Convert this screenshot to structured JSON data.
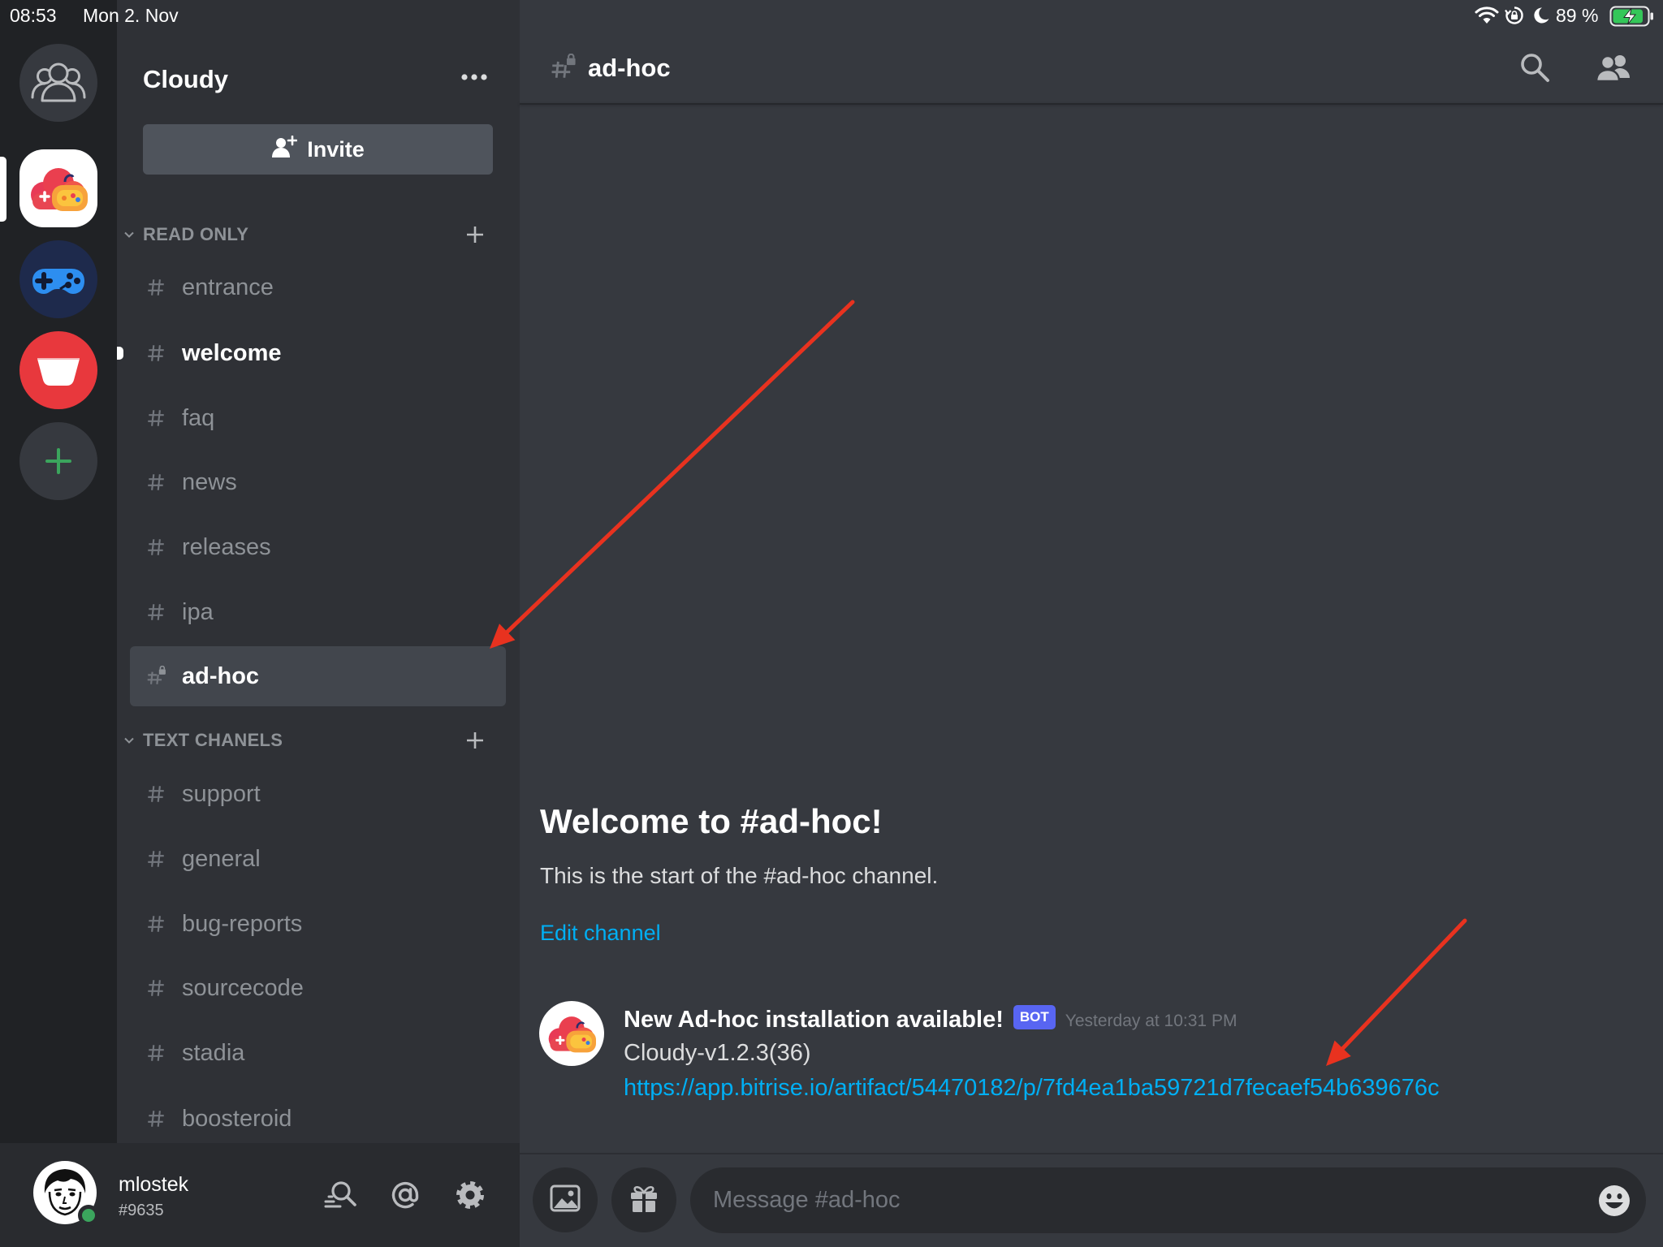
{
  "status_bar": {
    "time": "08:53",
    "date": "Mon 2. Nov",
    "battery": "89 %",
    "battery_level": 0.89,
    "icons": [
      "wifi-icon",
      "rotation-lock-icon",
      "do-not-disturb-icon",
      "battery-charging-icon"
    ]
  },
  "server_rail": {
    "items": [
      {
        "icon": "direct-messages-icon"
      },
      {
        "icon": "cloudy-server-icon",
        "selected": true
      },
      {
        "icon": "controller-server-icon"
      },
      {
        "icon": "red-bowl-server-icon"
      },
      {
        "icon": "add-server-icon"
      }
    ]
  },
  "sidebar": {
    "server_name": "Cloudy",
    "invite_label": "Invite",
    "categories": [
      {
        "name": "READ ONLY",
        "channels": [
          {
            "name": "entrance"
          },
          {
            "name": "welcome",
            "unread": true
          },
          {
            "name": "faq"
          },
          {
            "name": "news"
          },
          {
            "name": "releases"
          },
          {
            "name": "ipa"
          },
          {
            "name": "ad-hoc",
            "selected": true,
            "locked": true
          }
        ]
      },
      {
        "name": "TEXT CHANELS",
        "channels": [
          {
            "name": "support"
          },
          {
            "name": "general"
          },
          {
            "name": "bug-reports"
          },
          {
            "name": "sourcecode"
          },
          {
            "name": "stadia"
          },
          {
            "name": "boosteroid"
          }
        ]
      }
    ]
  },
  "user_panel": {
    "username": "mlostek",
    "discriminator": "#9635",
    "status": "online",
    "icons": [
      "friend-search-icon",
      "mentions-icon",
      "settings-gear-icon"
    ]
  },
  "channel_header": {
    "name": "ad-hoc",
    "icons": [
      "locked-hash-icon",
      "search-icon",
      "members-icon"
    ]
  },
  "welcome": {
    "title": "Welcome to #ad-hoc!",
    "subtitle": "This is the start of the #ad-hoc channel.",
    "edit_link": "Edit channel"
  },
  "message": {
    "author": "New Ad-hoc installation available!",
    "badge": "BOT",
    "timestamp": "Yesterday at 10:31 PM",
    "content": "Cloudy-v1.2.3(36)",
    "link": "https://app.bitrise.io/artifact/54470182/p/7fd4ea1ba59721d7fecaef54b639676c"
  },
  "composer": {
    "placeholder": "Message #ad-hoc",
    "icons": [
      "image-upload-icon",
      "gift-icon",
      "emoji-icon"
    ]
  },
  "colors": {
    "rail_bg": "#202225",
    "sidebar_bg": "#2f3136",
    "main_bg": "#36393f",
    "accent": "#5865f2",
    "link": "#00aff4",
    "online": "#3ba55d",
    "annotation_arrow": "#e8321f"
  }
}
